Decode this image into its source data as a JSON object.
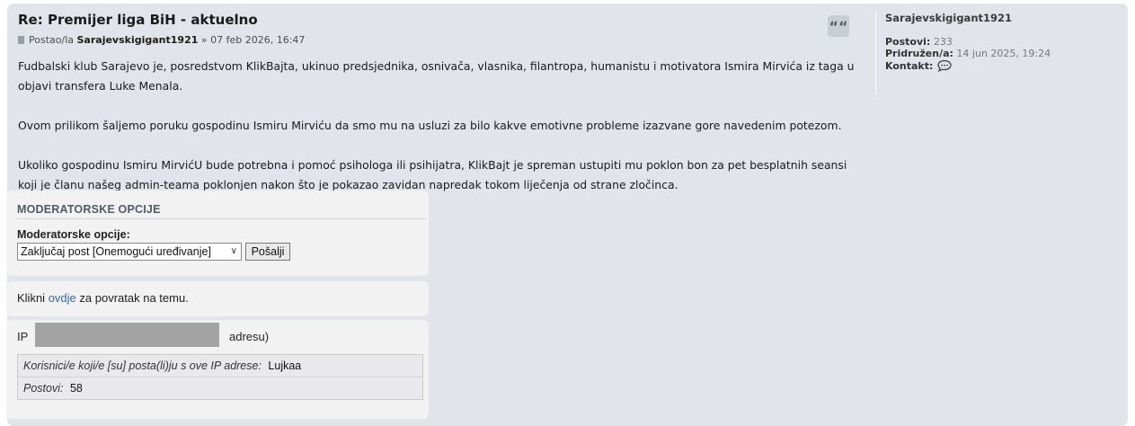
{
  "post": {
    "title": "Re: Premijer liga BiH - aktuelno",
    "meta": {
      "prefix": "Postao/la",
      "author": "Sarajevskigigant1921",
      "date": "» 07 feb 2026, 16:47"
    },
    "quote_glyph": "““",
    "paragraphs": [
      "Fudbalski klub Sarajevo je, posredstvom KlikBajta, ukinuo predsjednika, osnivača, vlasnika, filantropa, humanistu i motivatora Ismira Mirvića iz taga u objavi transfera Luke Menala.",
      "Ovom prilikom šaljemo poruku gospodinu Ismiru Mirviću da smo mu na usluzi za bilo kakve emotivne probleme izazvane gore navedenim potezom.",
      "Ukoliko gospodinu Ismiru MirvićU bude potrebna i pomoć psihologa ili psihijatra, KlikBajt je spreman ustupiti mu poklon bon za pet besplatnih seansi koji je članu našeg admin-teama poklonjen nakon što je pokazao zavidan napredak tokom liječenja od strane zločinca."
    ]
  },
  "profile": {
    "username": "Sarajevskigigant1921",
    "posts_label": "Postovi:",
    "posts_value": "233",
    "joined_label": "Pridružen/a:",
    "joined_value": "14 jun 2025, 19:24",
    "contact_label": "Kontakt:"
  },
  "moderator": {
    "heading": "MODERATORSKE OPCIJE",
    "label": "Moderatorske opcije:",
    "selected_option": "Zaključaj post [Onemogući uređivanje]",
    "submit_label": "Pošalji"
  },
  "back": {
    "prefix": "Klikni",
    "link": "ovdje",
    "suffix": "za povratak na temu."
  },
  "ip": {
    "label": "IP",
    "suffix": "adresu)",
    "users_label": "Korisnici/e koji/e [su] posta(li)ju s ove IP adrese:",
    "users_value": "Lujkaa",
    "posts_label": "Postovi:",
    "posts_value": "58"
  },
  "colors": {
    "post_bg": "#e1e4ea",
    "link": "#2b6bb5",
    "panel_bg": "#f2f2f3"
  }
}
